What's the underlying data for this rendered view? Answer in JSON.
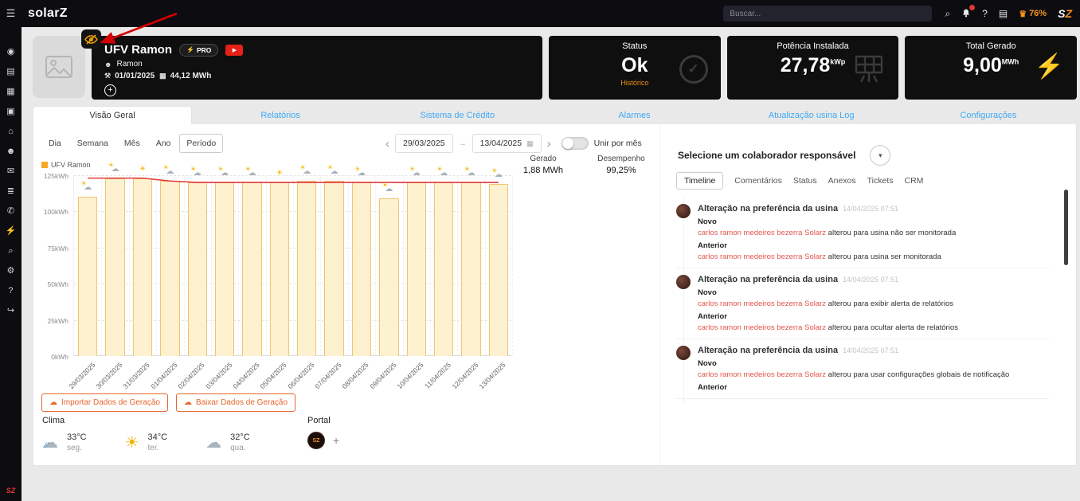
{
  "topbar": {
    "logo": "solarZ",
    "search_placeholder": "Buscar...",
    "battery_percent": "76%"
  },
  "icons": {
    "menu": "☰",
    "search": "⌕",
    "help": "?",
    "clipboard": "▤",
    "crown": "♛",
    "caret_down": "▾",
    "person": "☻",
    "wrench": "⚒",
    "calendar": "▦",
    "check": "✓",
    "play": "▶",
    "bolt": "⚡",
    "chevron_left": "‹",
    "chevron_right": "›",
    "plus": "+",
    "cloud_upload": "☁",
    "cloud_download": "☁"
  },
  "sidebar": {
    "items": [
      {
        "name": "overview",
        "glyph": "◉"
      },
      {
        "name": "charts",
        "glyph": "▤"
      },
      {
        "name": "reports",
        "glyph": "▦"
      },
      {
        "name": "screens",
        "glyph": "▣"
      },
      {
        "name": "home",
        "glyph": "⌂"
      },
      {
        "name": "clients",
        "glyph": "☻"
      },
      {
        "name": "messages",
        "glyph": "✉"
      },
      {
        "name": "plants",
        "glyph": "≣"
      },
      {
        "name": "whatsapp",
        "glyph": "✆"
      },
      {
        "name": "energy",
        "glyph": "⚡"
      },
      {
        "name": "search",
        "glyph": "⌕"
      },
      {
        "name": "settings",
        "glyph": "⚙"
      },
      {
        "name": "help",
        "glyph": "?"
      },
      {
        "name": "logout",
        "glyph": "↪"
      }
    ],
    "bottom_logo": "SZ"
  },
  "plant": {
    "title": "UFV Ramon",
    "pro_badge": "PRO",
    "owner": "Ramon",
    "install_date": "01/01/2025",
    "lifetime_total": "44,12 MWh",
    "add_label": "+"
  },
  "cards": {
    "status": {
      "title": "Status",
      "value": "Ok",
      "link": "Histórico"
    },
    "power": {
      "title": "Potência Instalada",
      "value": "27,78",
      "unit": "kWp"
    },
    "generated": {
      "title": "Total Gerado",
      "value": "9,00",
      "unit": "MWh"
    }
  },
  "tabs": [
    {
      "label": "Visão Geral",
      "active": true
    },
    {
      "label": "Relatórios",
      "active": false
    },
    {
      "label": "Sistema de Crédito",
      "active": false
    },
    {
      "label": "Alarmes",
      "active": false
    },
    {
      "label": "Atualização usina Log",
      "active": false
    },
    {
      "label": "Configurações",
      "active": false
    }
  ],
  "period_buttons": [
    {
      "label": "Dia",
      "active": false
    },
    {
      "label": "Semana",
      "active": false
    },
    {
      "label": "Mês",
      "active": false
    },
    {
      "label": "Ano",
      "active": false
    },
    {
      "label": "Período",
      "active": true
    }
  ],
  "date_range": {
    "start": "29/03/2025",
    "arrow": "→",
    "end": "13/04/2025"
  },
  "toggle": {
    "label": "Unir por mês",
    "on": false
  },
  "stats": {
    "gerado": {
      "label": "Gerado",
      "value": "1,88 MWh"
    },
    "desempenho": {
      "label": "Desempenho",
      "value": "99,25%"
    }
  },
  "chart_data": {
    "type": "bar",
    "legend": "UFV Ramon",
    "ylim": [
      0,
      125
    ],
    "yticks": [
      0,
      25,
      50,
      75,
      100,
      125
    ],
    "ytick_suffix": "kWh",
    "grid": true,
    "categories": [
      "29/03/2025",
      "30/03/2025",
      "31/03/2025",
      "01/04/2025",
      "02/04/2025",
      "03/04/2025",
      "04/04/2025",
      "05/04/2025",
      "06/04/2025",
      "07/04/2025",
      "08/04/2025",
      "09/04/2025",
      "10/04/2025",
      "11/04/2025",
      "12/04/2025",
      "13/04/2025"
    ],
    "values": [
      110,
      123,
      123,
      121,
      120,
      120,
      120,
      120,
      121,
      121,
      120,
      109,
      120,
      120,
      120,
      119
    ],
    "line_series": {
      "name": "expected",
      "color": "#e03a3a",
      "values": [
        123,
        123,
        123,
        121,
        120,
        120,
        120,
        120,
        120,
        120,
        120,
        120,
        120,
        120,
        120,
        120
      ]
    },
    "weather": [
      "partly",
      "partly",
      "sun",
      "partly",
      "partly",
      "partly",
      "partly",
      "sun",
      "partly",
      "partly",
      "partly",
      "partly",
      "partly",
      "partly",
      "partly",
      "partly"
    ]
  },
  "actions": {
    "import_label": "Importar Dados de Geração",
    "download_label": "Baixar Dados de Geração"
  },
  "clima": {
    "title": "Clima",
    "days": [
      {
        "icon": "rain",
        "temp": "33°C",
        "day": "seg."
      },
      {
        "icon": "sun",
        "temp": "34°C",
        "day": "ter."
      },
      {
        "icon": "cloud",
        "temp": "32°C",
        "day": "qua."
      }
    ]
  },
  "portal": {
    "title": "Portal",
    "logo": "SZ",
    "add_label": "+"
  },
  "collaborator": {
    "label": "Selecione um colaborador responsável"
  },
  "timeline_tabs": [
    {
      "label": "Timeline",
      "active": true
    },
    {
      "label": "Comentários",
      "active": false
    },
    {
      "label": "Status",
      "active": false
    },
    {
      "label": "Anexos",
      "active": false
    },
    {
      "label": "Tickets",
      "active": false
    },
    {
      "label": "CRM",
      "active": false
    }
  ],
  "timeline": [
    {
      "title": "Alteração na preferência da usina",
      "timestamp": "14/04/2025 07:51",
      "novo_label": "Novo",
      "novo_author": "carlos ramon medeiros bezerra Solarz",
      "novo_text": "alterou para usina não ser monitorada",
      "anterior_label": "Anterior",
      "anterior_author": "carlos ramon medeiros bezerra Solarz",
      "anterior_text": "alterou para usina ser monitorada"
    },
    {
      "title": "Alteração na preferência da usina",
      "timestamp": "14/04/2025 07:51",
      "novo_label": "Novo",
      "novo_author": "carlos ramon medeiros bezerra Solarz",
      "novo_text": "alterou para exibir alerta de relatórios",
      "anterior_label": "Anterior",
      "anterior_author": "carlos ramon medeiros bezerra Solarz",
      "anterior_text": "alterou para ocultar alerta de relatórios"
    },
    {
      "title": "Alteração na preferência da usina",
      "timestamp": "14/04/2025 07:51",
      "novo_label": "Novo",
      "novo_author": "carlos ramon medeiros bezerra Solarz",
      "novo_text": "alterou para usar configurações globais de notificação",
      "anterior_label": "Anterior",
      "anterior_author": "",
      "anterior_text": ""
    }
  ]
}
